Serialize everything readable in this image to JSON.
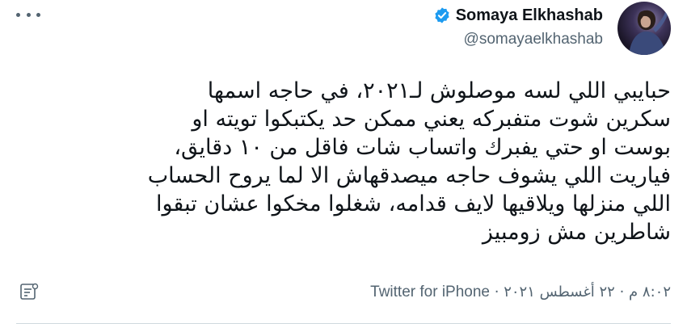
{
  "author": {
    "display_name": "Somaya Elkhashab",
    "handle": "@somayaelkhashab",
    "verified": true,
    "avatar_icon": "profile-photo",
    "verified_icon": "verified-badge-icon",
    "verified_color": "#1d9bf0"
  },
  "tweet": {
    "lines": [
      "حبايبي اللي لسه موصلوش لـ٢٠٢١، في حاجه اسمها",
      "سكرين شوت متفبركه يعني ممكن حد يكتبكوا تويته او",
      "بوست او حتي يفبرك واتساب شات فاقل من ١٠ دقايق،",
      "فياريت اللي يشوف حاجه ميصدقهاش الا لما يروح الحساب",
      "اللي منزلها ويلاقيها لايف قدامه، شغلوا مخكوا عشان تبقوا",
      "شاطرين مش زومبيز"
    ]
  },
  "meta": {
    "time": "٨:٠٢ م",
    "separator": "·",
    "date": "٢٢ أغسطس ٢٠٢١",
    "source": "Twitter for iPhone"
  },
  "icons": {
    "more": "more-options-icon",
    "analytics": "tweet-analytics-icon"
  },
  "colors": {
    "text": "#0f1419",
    "secondary": "#536471",
    "accent": "#1d9bf0",
    "divider": "#cfd9de"
  }
}
